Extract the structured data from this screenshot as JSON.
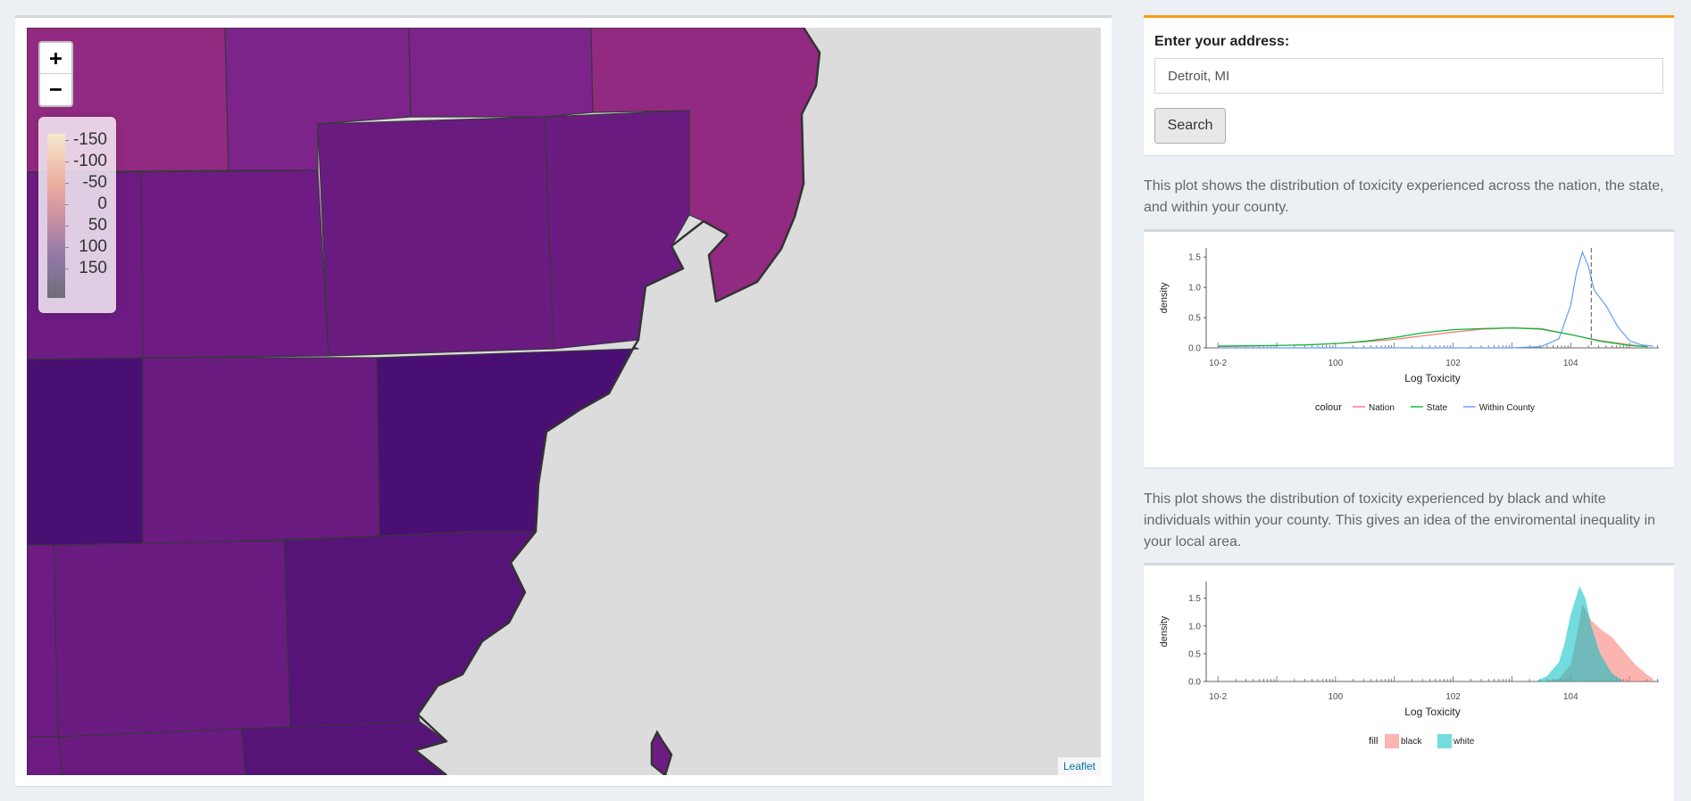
{
  "map": {
    "zoom_in_label": "+",
    "zoom_out_label": "−",
    "legend": {
      "labels": [
        "-150",
        "-100",
        "-50",
        "0",
        "50",
        "100",
        "150"
      ],
      "colors": [
        "#f6e9cf",
        "#ecae9e",
        "#c88fa2",
        "#9179a6",
        "#6f6e79"
      ]
    },
    "attribution": "Leaflet",
    "region_colors": {
      "magenta": "#932a82",
      "violet_light": "#7c248a",
      "violet": "#6a1b80",
      "violet_mid": "#6e1c83",
      "indigo": "#4a0f73",
      "indigo_mid": "#561478",
      "water": "#dcdcdc"
    }
  },
  "address": {
    "label": "Enter your address:",
    "value": "Detroit, MI",
    "button": "Search",
    "accent_color": "#f39c12"
  },
  "description1": "This plot shows the distribution of toxicity experienced across the nation, the state, and within your county.",
  "description2": "This plot shows the distribution of toxicity experienced by black and white individuals within your county. This gives an idea of the enviromental inequality in your local area.",
  "chart_data": [
    {
      "type": "line",
      "title": "",
      "xlabel": "Log Toxicity",
      "ylabel": "density",
      "xscale": "log10",
      "xticks": [
        "10^-2",
        "10^0",
        "10^2",
        "10^4"
      ],
      "yticks": [
        "0.0",
        "0.5",
        "1.0",
        "1.5"
      ],
      "xlim_log10": [
        -2.2,
        5.5
      ],
      "ylim": [
        0,
        1.65
      ],
      "grid": false,
      "legend_title": "colour",
      "legend_position": "bottom",
      "vline_log10": 4.35,
      "series": [
        {
          "name": "Nation",
          "color": "#f8766d",
          "x_log10": [
            -2,
            -1.5,
            -1,
            -0.5,
            0,
            0.5,
            1,
            1.5,
            2,
            2.5,
            3,
            3.5,
            4,
            4.5,
            5,
            5.3
          ],
          "y": [
            0.02,
            0.03,
            0.04,
            0.05,
            0.07,
            0.1,
            0.14,
            0.2,
            0.26,
            0.31,
            0.33,
            0.32,
            0.22,
            0.12,
            0.05,
            0.02
          ]
        },
        {
          "name": "State",
          "color": "#00ba38",
          "x_log10": [
            -2,
            -1.5,
            -1,
            -0.5,
            0,
            0.5,
            1,
            1.5,
            2,
            2.5,
            3,
            3.5,
            4,
            4.5,
            5,
            5.3
          ],
          "y": [
            0.03,
            0.035,
            0.04,
            0.05,
            0.07,
            0.11,
            0.17,
            0.25,
            0.3,
            0.32,
            0.33,
            0.31,
            0.22,
            0.11,
            0.04,
            0.02
          ]
        },
        {
          "name": "Within County",
          "color": "#619cff",
          "x_log10": [
            -2,
            -1,
            0,
            1,
            2,
            3,
            3.5,
            3.8,
            4.0,
            4.1,
            4.2,
            4.3,
            4.4,
            4.6,
            4.8,
            5.0,
            5.2,
            5.4
          ],
          "y": [
            0.0,
            0.0,
            0.0,
            0.0,
            0.0,
            0.0,
            0.02,
            0.15,
            0.7,
            1.25,
            1.58,
            1.35,
            0.95,
            0.7,
            0.35,
            0.12,
            0.05,
            0.03
          ]
        }
      ]
    },
    {
      "type": "area",
      "title": "",
      "xlabel": "Log Toxicity",
      "ylabel": "density",
      "xscale": "log10",
      "xticks": [
        "10^-2",
        "10^0",
        "10^2",
        "10^4"
      ],
      "yticks": [
        "0.0",
        "0.5",
        "1.0",
        "1.5"
      ],
      "xlim_log10": [
        -2.2,
        5.5
      ],
      "ylim": [
        0,
        1.8
      ],
      "grid": false,
      "legend_title": "fill",
      "legend_position": "bottom",
      "series": [
        {
          "name": "black",
          "color": "#f8766d",
          "x_log10": [
            3.5,
            3.8,
            4.0,
            4.1,
            4.2,
            4.35,
            4.5,
            4.7,
            4.9,
            5.1,
            5.3,
            5.4
          ],
          "y": [
            0.0,
            0.05,
            0.3,
            0.8,
            1.4,
            1.1,
            0.95,
            0.8,
            0.55,
            0.3,
            0.12,
            0.05
          ]
        },
        {
          "name": "white",
          "color": "#00bfc4",
          "x_log10": [
            3.4,
            3.6,
            3.8,
            3.9,
            4.0,
            4.1,
            4.15,
            4.25,
            4.35,
            4.5,
            4.7,
            4.9
          ],
          "y": [
            0.0,
            0.1,
            0.35,
            0.7,
            1.2,
            1.55,
            1.72,
            1.5,
            1.0,
            0.5,
            0.15,
            0.0
          ]
        }
      ]
    }
  ]
}
